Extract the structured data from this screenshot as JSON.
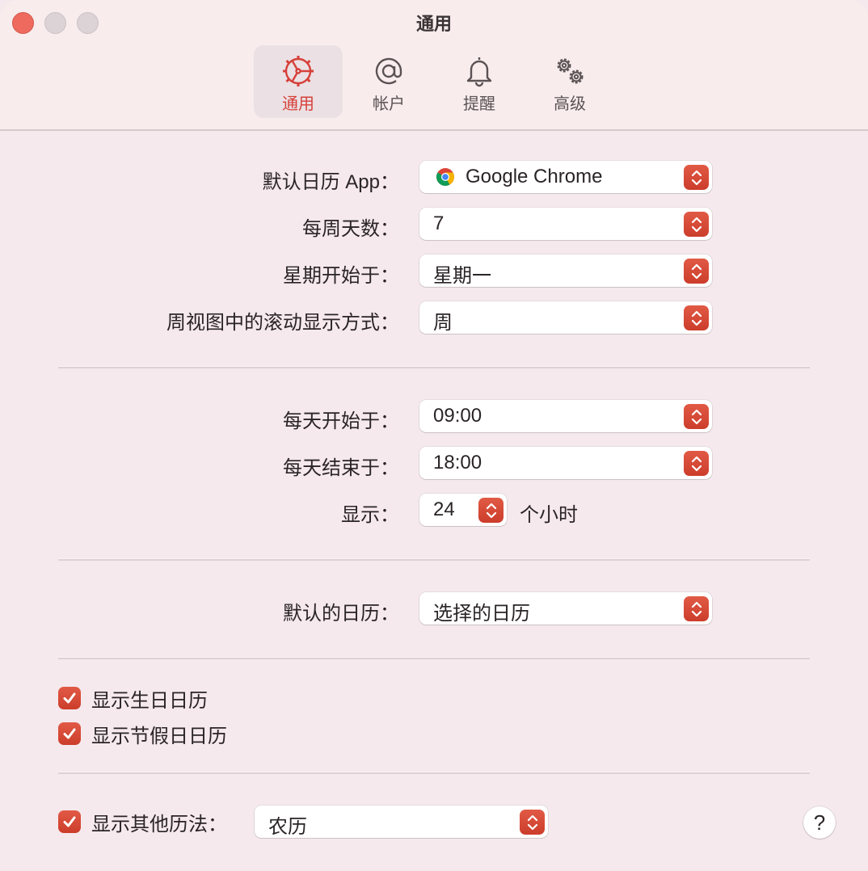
{
  "window": {
    "title": "通用",
    "accent_color": "#d6403a"
  },
  "toolbar": {
    "tabs": [
      {
        "label": "通用",
        "icon": "gear-steering-icon",
        "active": true
      },
      {
        "label": "帐户",
        "icon": "at-sign-icon",
        "active": false
      },
      {
        "label": "提醒",
        "icon": "bell-icon",
        "active": false
      },
      {
        "label": "高级",
        "icon": "gears-icon",
        "active": false
      }
    ]
  },
  "section1": {
    "default_app": {
      "label": "默认日历 App：",
      "value": "Google Chrome",
      "icon": "chrome-icon"
    },
    "days_per_week": {
      "label": "每周天数：",
      "value": "7"
    },
    "week_starts": {
      "label": "星期开始于：",
      "value": "星期一"
    },
    "scroll_mode": {
      "label": "周视图中的滚动显示方式：",
      "value": "周"
    }
  },
  "section2": {
    "day_start": {
      "label": "每天开始于：",
      "value": "09:00"
    },
    "day_end": {
      "label": "每天结束于：",
      "value": "18:00"
    },
    "show_hours": {
      "label": "显示：",
      "value": "24",
      "unit": "个小时"
    }
  },
  "section3": {
    "default_calendar": {
      "label": "默认的日历：",
      "value": "选择的日历"
    }
  },
  "section4": {
    "show_birthdays": {
      "label": "显示生日日历",
      "checked": true
    },
    "show_holidays": {
      "label": "显示节假日日历",
      "checked": true
    }
  },
  "section5": {
    "show_alt_calendar": {
      "label": "显示其他历法：",
      "checked": true,
      "value": "农历"
    },
    "help_label": "?"
  }
}
